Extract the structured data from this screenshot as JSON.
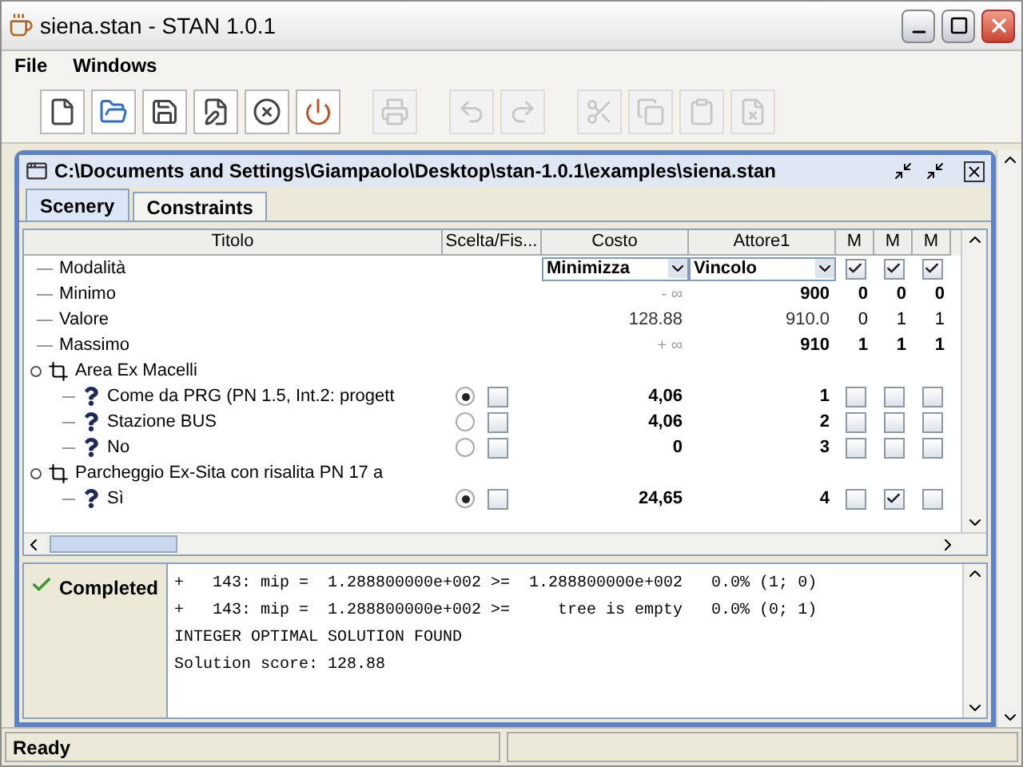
{
  "window": {
    "title": "siena.stan - STAN 1.0.1"
  },
  "menu": [
    "File",
    "Windows"
  ],
  "toolbar": [
    {
      "disabled": false
    },
    {
      "disabled": false
    },
    {
      "disabled": false
    },
    {
      "disabled": false
    },
    {
      "disabled": false
    },
    {
      "disabled": false
    },
    {
      "disabled": true
    },
    {
      "disabled": true
    },
    {
      "disabled": true
    },
    {
      "disabled": true
    },
    {
      "disabled": true
    },
    {
      "disabled": true
    },
    {
      "disabled": true
    }
  ],
  "document": {
    "title": "C:\\Documents and Settings\\Giampaolo\\Desktop\\stan-1.0.1\\examples\\siena.stan",
    "tabs": [
      {
        "label": "Scenery",
        "selected": true
      },
      {
        "label": "Constraints",
        "selected": false
      }
    ],
    "columns": [
      "Titolo",
      "Scelta/Fis...",
      "Costo",
      "Attore1",
      "M",
      "M",
      "M"
    ],
    "summary": [
      {
        "kind": "dropdowns",
        "label": "Modalità",
        "cost": "Minimizza",
        "actor": "Vincolo",
        "m": [
          true,
          true,
          true
        ]
      },
      {
        "kind": "bounds",
        "label": "Minimo",
        "bold": true,
        "cost": "- ∞",
        "actor": "900",
        "m": [
          "0",
          "0",
          "0"
        ]
      },
      {
        "kind": "bounds",
        "label": "Valore",
        "bold": false,
        "cost": "128.88",
        "actor": "910.0",
        "m": [
          "0",
          "1",
          "1"
        ]
      },
      {
        "kind": "bounds",
        "label": "Massimo",
        "bold": true,
        "cost": "+ ∞",
        "actor": "910",
        "m": [
          "1",
          "1",
          "1"
        ]
      }
    ],
    "groups": [
      {
        "label": "Area Ex Macelli",
        "expanded": true,
        "children": [
          {
            "label": "Come da PRG (PN 1.5, Int.2: progett",
            "selected": true,
            "fixed": false,
            "cost": "4,06",
            "actor": "1",
            "m": [
              false,
              false,
              false
            ]
          },
          {
            "label": "Stazione BUS",
            "selected": false,
            "fixed": false,
            "cost": "4,06",
            "actor": "2",
            "m": [
              false,
              false,
              false
            ]
          },
          {
            "label": "No",
            "selected": false,
            "fixed": false,
            "cost": "0",
            "actor": "3",
            "m": [
              false,
              false,
              false
            ]
          }
        ]
      },
      {
        "label": "Parcheggio Ex-Sita con risalita PN 17 a",
        "expanded": true,
        "children": [
          {
            "label": "Sì",
            "selected": true,
            "fixed": false,
            "cost": "24,65",
            "actor": "4",
            "m": [
              false,
              true,
              false
            ]
          }
        ]
      }
    ]
  },
  "log": {
    "status": "Completed",
    "lines": [
      "+   143: mip =  1.288800000e+002 >=  1.288800000e+002   0.0% (1; 0)",
      "+   143: mip =  1.288800000e+002 >=     tree is empty   0.0% (0; 1)",
      "INTEGER OPTIMAL SOLUTION FOUND",
      "Solution score: 128.88"
    ]
  },
  "status_bar": {
    "message": "Ready"
  }
}
